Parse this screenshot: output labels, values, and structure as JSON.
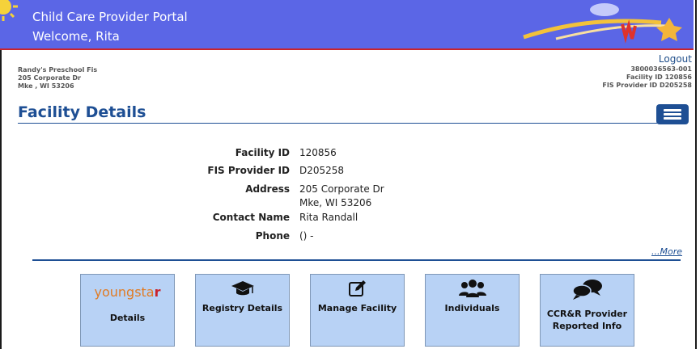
{
  "header": {
    "app_title": "Child Care Provider Portal",
    "welcome": "Welcome, Rita"
  },
  "facility": {
    "name": "Randy's Preschool Fis",
    "street": "205 Corporate Dr",
    "city": "Mke , WI 53206"
  },
  "account": {
    "logout": "Logout",
    "case_number": "3800036563-001",
    "facility_id_line": "Facility ID 120856",
    "fis_provider_line": "FIS Provider ID D205258"
  },
  "page_title": "Facility Details",
  "details": {
    "facility_id_label": "Facility ID",
    "facility_id": "120856",
    "fis_provider_label": "FIS Provider ID",
    "fis_provider": "D205258",
    "address_label": "Address",
    "address_line1": "205 Corporate Dr",
    "address_line2": "Mke, WI 53206",
    "contact_label": "Contact Name",
    "contact": "Rita Randall",
    "phone_label": "Phone",
    "phone": "() -"
  },
  "more_link": "...More",
  "tiles": {
    "youngstar_logo": "youngstar",
    "youngstar": "Details",
    "registry": "Registry Details",
    "manage": "Manage Facility",
    "individuals": "Individuals",
    "ccrr_line1": "CCR&R Provider",
    "ccrr_line2": "Reported Info"
  },
  "icons": {
    "menu": "hamburger-menu-icon",
    "registry": "graduation-cap-icon",
    "manage": "edit-icon",
    "individuals": "users-icon",
    "ccrr": "comments-icon"
  },
  "colors": {
    "banner": "#5b66e6",
    "accent": "#1e4f94",
    "tile": "#b8d2f5",
    "youngstar": "#e07b24"
  }
}
